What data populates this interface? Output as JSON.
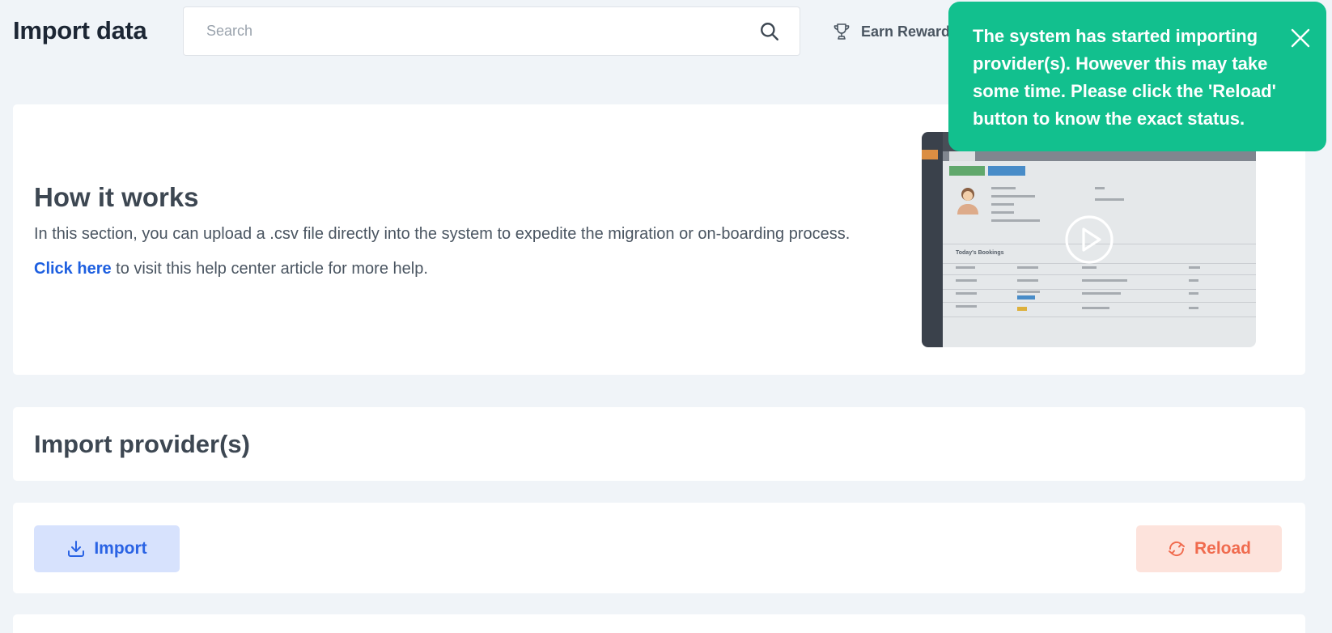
{
  "header": {
    "title": "Import data",
    "search_placeholder": "Search",
    "rewards_label": "Earn Rewards"
  },
  "how_it_works": {
    "title": "How it works",
    "description": "In this section, you can upload a .csv file directly into the system to expedite the migration or on-boarding process.",
    "help_link": "Click here",
    "help_text": " to visit this help center article for more help.",
    "video_section_label": "Today's Bookings"
  },
  "provider": {
    "title": "Import provider(s)"
  },
  "actions": {
    "import_label": "Import",
    "reload_label": "Reload"
  },
  "toast": {
    "message": "The system has started importing provider(s). However this may take some time. Please click the 'Reload' button to know the exact status."
  },
  "colors": {
    "background": "#f0f4f8",
    "toast": "#12c08e",
    "link": "#1d5fe0",
    "import_bg": "#d7e2fd",
    "reload_bg": "#fde3dc",
    "reload_text": "#f06b4e"
  },
  "icons": {
    "search": "search-icon",
    "rewards": "trophy-icon",
    "import": "download-icon",
    "reload": "refresh-icon",
    "close": "close-icon",
    "video": "play-icon"
  }
}
